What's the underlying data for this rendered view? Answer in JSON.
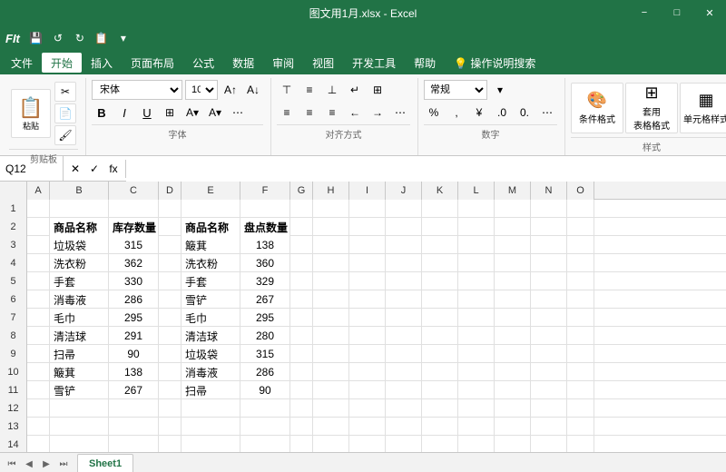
{
  "titleBar": {
    "title": "图文用1月.xlsx - Excel",
    "minimizeLabel": "−",
    "maximizeLabel": "□",
    "closeLabel": "✕"
  },
  "quickToolbar": {
    "fitText": "FIt",
    "undoLabel": "↺",
    "redoLabel": "↻",
    "saveLabel": "💾",
    "buttons": [
      "💾",
      "↺",
      "↻",
      "📋",
      "📷"
    ]
  },
  "menuBar": {
    "items": [
      "文件",
      "开始",
      "插入",
      "页面布局",
      "公式",
      "数据",
      "审阅",
      "视图",
      "开发工具",
      "帮助",
      "💡 操作说明搜索"
    ]
  },
  "ribbon": {
    "groups": [
      {
        "label": "剪贴板"
      },
      {
        "label": "字体"
      },
      {
        "label": "对齐方式"
      },
      {
        "label": "数字"
      },
      {
        "label": "样式"
      }
    ],
    "fontName": "宋体",
    "fontSize": "10",
    "numberFormat": "常规",
    "boldLabel": "B",
    "italicLabel": "I",
    "underlineLabel": "U",
    "conditionalFormatLabel": "条件格式",
    "tableFormatLabel": "套用\n表格格式",
    "cellStyleLabel": "单元格\n样式"
  },
  "formulaBar": {
    "cellRef": "Q12",
    "cancelLabel": "✕",
    "confirmLabel": "✓",
    "fxLabel": "fx",
    "formula": ""
  },
  "columns": {
    "headers": [
      "A",
      "B",
      "C",
      "D",
      "E",
      "F",
      "G",
      "H",
      "I",
      "J",
      "K",
      "L",
      "M",
      "N",
      "O"
    ]
  },
  "rows": [
    {
      "num": 1,
      "cells": [
        "",
        "",
        "",
        "",
        "",
        "",
        "",
        "",
        "",
        "",
        "",
        "",
        "",
        "",
        ""
      ]
    },
    {
      "num": 2,
      "cells": [
        "",
        "商品名称",
        "库存数量",
        "",
        "商品名称",
        "盘点数量",
        "",
        "",
        "",
        "",
        "",
        "",
        "",
        "",
        ""
      ]
    },
    {
      "num": 3,
      "cells": [
        "",
        "垃圾袋",
        "315",
        "",
        "簸萁",
        "138",
        "",
        "",
        "",
        "",
        "",
        "",
        "",
        "",
        ""
      ]
    },
    {
      "num": 4,
      "cells": [
        "",
        "洗衣粉",
        "362",
        "",
        "洗衣粉",
        "360",
        "",
        "",
        "",
        "",
        "",
        "",
        "",
        "",
        ""
      ]
    },
    {
      "num": 5,
      "cells": [
        "",
        "手套",
        "330",
        "",
        "手套",
        "329",
        "",
        "",
        "",
        "",
        "",
        "",
        "",
        "",
        ""
      ]
    },
    {
      "num": 6,
      "cells": [
        "",
        "消毒液",
        "286",
        "",
        "雪铲",
        "267",
        "",
        "",
        "",
        "",
        "",
        "",
        "",
        "",
        ""
      ]
    },
    {
      "num": 7,
      "cells": [
        "",
        "毛巾",
        "295",
        "",
        "毛巾",
        "295",
        "",
        "",
        "",
        "",
        "",
        "",
        "",
        "",
        ""
      ]
    },
    {
      "num": 8,
      "cells": [
        "",
        "清洁球",
        "291",
        "",
        "清洁球",
        "280",
        "",
        "",
        "",
        "",
        "",
        "",
        "",
        "",
        ""
      ]
    },
    {
      "num": 9,
      "cells": [
        "",
        "扫帚",
        "90",
        "",
        "垃圾袋",
        "315",
        "",
        "",
        "",
        "",
        "",
        "",
        "",
        "",
        ""
      ]
    },
    {
      "num": 10,
      "cells": [
        "",
        "簸萁",
        "138",
        "",
        "消毒液",
        "286",
        "",
        "",
        "",
        "",
        "",
        "",
        "",
        "",
        ""
      ]
    },
    {
      "num": 11,
      "cells": [
        "",
        "雪铲",
        "267",
        "",
        "扫帚",
        "90",
        "",
        "",
        "",
        "",
        "",
        "",
        "",
        "",
        ""
      ]
    },
    {
      "num": 12,
      "cells": [
        "",
        "",
        "",
        "",
        "",
        "",
        "",
        "",
        "",
        "",
        "",
        "",
        "",
        "",
        ""
      ]
    },
    {
      "num": 13,
      "cells": [
        "",
        "",
        "",
        "",
        "",
        "",
        "",
        "",
        "",
        "",
        "",
        "",
        "",
        "",
        ""
      ]
    },
    {
      "num": 14,
      "cells": [
        "",
        "",
        "",
        "",
        "",
        "",
        "",
        "",
        "",
        "",
        "",
        "",
        "",
        "",
        ""
      ]
    }
  ],
  "sheetTabs": {
    "activeTab": "Sheet1",
    "tabs": [
      "Sheet1"
    ]
  }
}
